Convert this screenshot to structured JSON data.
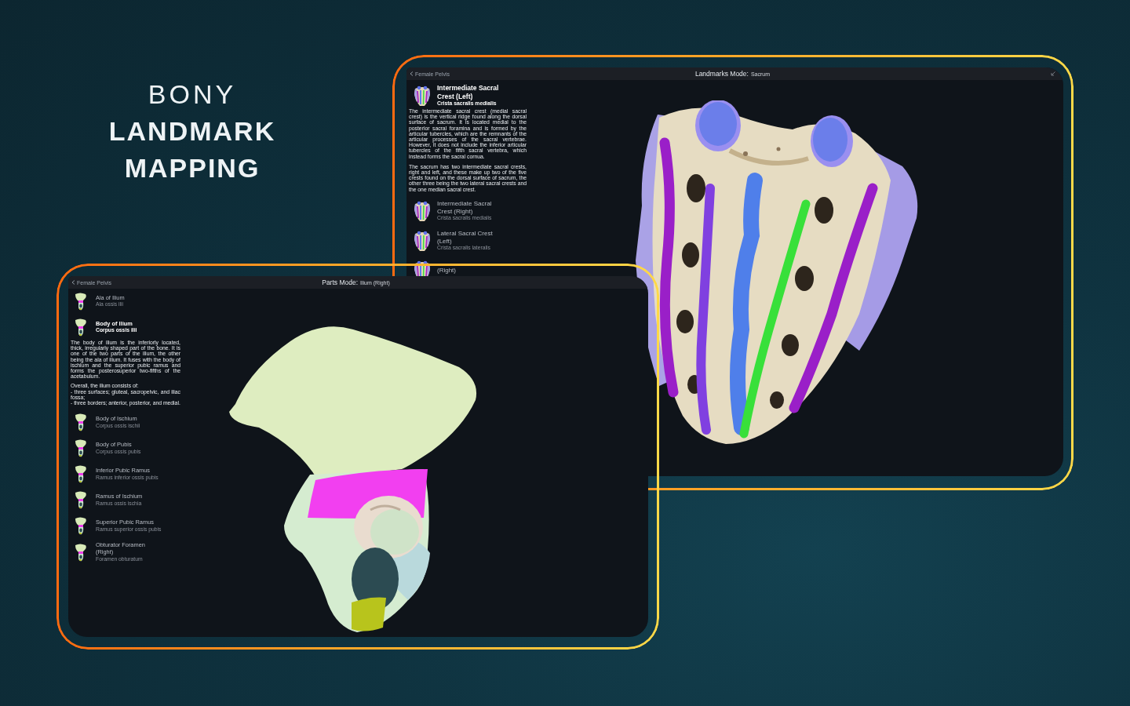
{
  "heading": {
    "lead": "BONY",
    "lines": [
      "LANDMARK",
      "MAPPING"
    ]
  },
  "windows": [
    {
      "back_label": "Female Pelvis",
      "mode": "Landmarks Mode:",
      "subject": "Sacrum",
      "items": [
        {
          "name": "Intermediate Sacral Crest (Left)",
          "latin": "Crista sacralis medialis",
          "selected": true,
          "description": [
            "The intermediate sacral crest (medial sacral crest) is the vertical ridge found along the dorsal surface of sacrum. It is located medial to the posterior sacral foramina and is formed by the articular tubercles, which are the remnants of the articular processes of the sacral vertebrae. However, it does not include the inferior articular tubercles of the fifth sacral vertebra, which instead forms the sacral cornua.",
            "The sacrum has two intermediate sacral crests, right and left, and these make up two of the five crests found on the dorsal surface of sacrum, the other three being the two lateral sacral crests and the one median sacral crest."
          ]
        },
        {
          "name": "Intermediate Sacral Crest (Right)",
          "latin": "Crista sacralis medialis",
          "selected": false
        },
        {
          "name": "Lateral Sacral Crest (Left)",
          "latin": "Crista sacralis lateralis",
          "selected": false
        },
        {
          "name": "(Right)",
          "selected": false
        }
      ]
    },
    {
      "back_label": "Female Pelvis",
      "mode": "Parts Mode:",
      "subject": "Ilium (Right)",
      "items": [
        {
          "name": "Ala of Ilium",
          "latin": "Ala ossis ilii",
          "selected": false
        },
        {
          "name": "Body of Ilium",
          "latin": "Corpus ossis ilii",
          "selected": true,
          "description": [
            "The body of ilium is the inferiorly located, thick, irregularly shaped part of the bone. It is one of the two parts of the ilium, the other being the ala of ilium. It fuses with the body of ischium and the superior pubic ramus and forms the posterosuperior two-fifths of the acetabulum.",
            "Overall, the ilium consists of:\n- three surfaces; gluteal, sacropelvic, and iliac fossa;\n- three borders; anterior, posterior, and medial."
          ]
        },
        {
          "name": "Body of Ischium",
          "latin": "Corpus ossis ischii",
          "selected": false
        },
        {
          "name": "Body of Pubis",
          "latin": "Corpus ossis pubis",
          "selected": false
        },
        {
          "name": "Inferior Pubic Ramus",
          "latin": "Ramus inferior ossis pubis",
          "selected": false
        },
        {
          "name": "Ramus of Ischium",
          "latin": "Ramus ossis ischia",
          "selected": false
        },
        {
          "name": "Superior Pubic Ramus",
          "latin": "Ramus superior ossis pubis",
          "selected": false
        },
        {
          "name": "Obturator Foramen (Right)",
          "latin": "Foramen obturatum",
          "selected": false
        }
      ]
    }
  ]
}
